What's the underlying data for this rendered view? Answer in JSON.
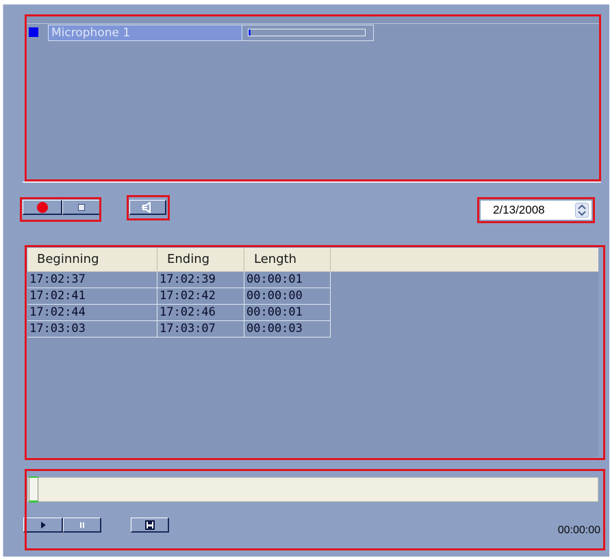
{
  "microphones": [
    {
      "name": "Microphone 1",
      "level": 0.02,
      "indicator_color": "#0000f0"
    }
  ],
  "controls": {
    "record_icon": "record-icon",
    "stop_icon": "stop-icon",
    "audio_icon": "speaker-icon",
    "date": "2/13/2008"
  },
  "table": {
    "columns": [
      "Beginning",
      "Ending",
      "Length"
    ],
    "rows": [
      [
        "17:02:37",
        "17:02:39",
        "00:00:01"
      ],
      [
        "17:02:41",
        "17:02:42",
        "00:00:00"
      ],
      [
        "17:02:44",
        "17:02:46",
        "00:00:01"
      ],
      [
        "17:03:03",
        "17:03:07",
        "00:00:03"
      ]
    ]
  },
  "playback": {
    "position": 0,
    "play_icon": "play-icon",
    "pause_icon": "pause-icon",
    "save_icon": "save-icon",
    "time": "00:00:00"
  },
  "colors": {
    "panel": "#8da0c4",
    "highlight": "#e0141e",
    "header": "#ece9d8"
  }
}
